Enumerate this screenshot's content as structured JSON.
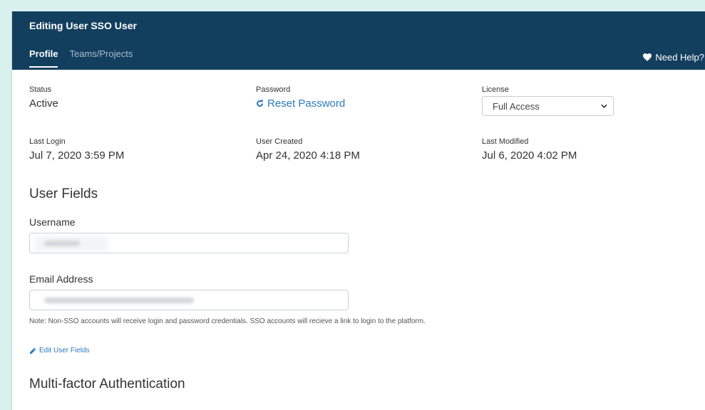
{
  "header": {
    "title": "Editing User SSO User",
    "tabs": [
      {
        "label": "Profile",
        "active": true
      },
      {
        "label": "Teams/Projects",
        "active": false
      }
    ],
    "help_label": "Need Help?"
  },
  "meta": {
    "status": {
      "label": "Status",
      "value": "Active"
    },
    "password": {
      "label": "Password",
      "action": "Reset Password"
    },
    "license": {
      "label": "License",
      "selected": "Full Access"
    },
    "last_login": {
      "label": "Last Login",
      "value": "Jul 7, 2020 3:59 PM"
    },
    "user_created": {
      "label": "User Created",
      "value": "Apr 24, 2020 4:18 PM"
    },
    "last_modified": {
      "label": "Last Modified",
      "value": "Jul 6, 2020 4:02 PM"
    }
  },
  "user_fields": {
    "title": "User Fields",
    "username_label": "Username",
    "email_label": "Email Address",
    "note": "Note: Non-SSO accounts will receive login and password credentials. SSO accounts will recieve a link to login to the platform.",
    "edit_link": "Edit User Fields"
  },
  "mfa": {
    "title": "Multi-factor Authentication"
  },
  "colors": {
    "header_bg": "#133f5f",
    "link": "#2a7bbd",
    "page_bg": "#d9f1ec"
  },
  "icons": {
    "help": "heart-icon",
    "reset": "refresh-icon",
    "edit": "pencil-icon",
    "select": "chevron-down-icon"
  }
}
